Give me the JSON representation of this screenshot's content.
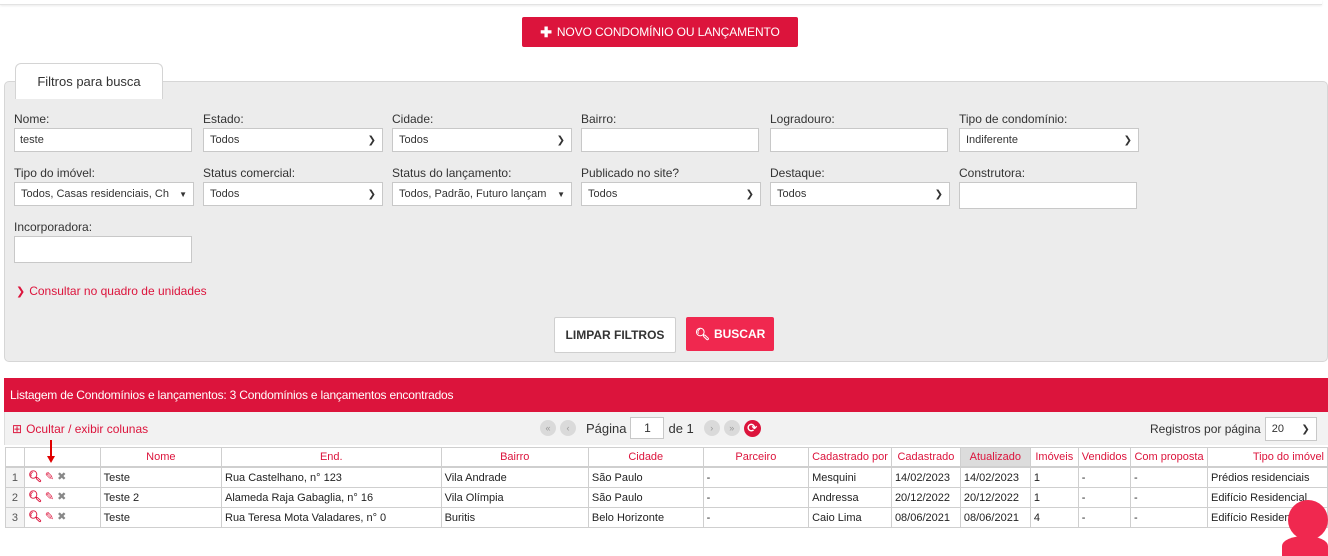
{
  "top_button": {
    "icon": "plus-icon",
    "label": "NOVO CONDOMÍNIO OU LANÇAMENTO"
  },
  "filters": {
    "tab_title": "Filtros para busca",
    "nome": {
      "label": "Nome:",
      "value": "teste"
    },
    "estado": {
      "label": "Estado:",
      "value": "Todos"
    },
    "cidade": {
      "label": "Cidade:",
      "value": "Todos"
    },
    "bairro": {
      "label": "Bairro:",
      "value": ""
    },
    "logradouro": {
      "label": "Logradouro:",
      "value": ""
    },
    "tipo_condominio": {
      "label": "Tipo de condomínio:",
      "value": "Indiferente"
    },
    "tipo_imovel": {
      "label": "Tipo do imóvel:",
      "value": "Todos, Casas residenciais, Ch"
    },
    "status_comercial": {
      "label": "Status comercial:",
      "value": "Todos"
    },
    "status_lancamento": {
      "label": "Status do lançamento:",
      "value": "Todos, Padrão, Futuro lançam"
    },
    "publicado": {
      "label": "Publicado no site?",
      "value": "Todos"
    },
    "destaque": {
      "label": "Destaque:",
      "value": "Todos"
    },
    "construtora": {
      "label": "Construtora:",
      "value": ""
    },
    "incorporadora": {
      "label": "Incorporadora:",
      "value": ""
    },
    "consult_link": "Consultar no quadro de unidades",
    "clear_label": "LIMPAR FILTROS",
    "search_label": "BUSCAR"
  },
  "listing": {
    "title": "Listagem de Condomínios e lançamentos: 3 Condomínios e lançamentos encontrados",
    "toggle_columns": "Ocultar / exibir colunas",
    "page_label": "Página",
    "page_value": "1",
    "page_of": "de 1",
    "per_page_label": "Registros por página",
    "per_page_value": "20",
    "columns": [
      "",
      "",
      "Nome",
      "End.",
      "Bairro",
      "Cidade",
      "Parceiro",
      "Cadastrado por",
      "Cadastrado",
      "Atualizado",
      "Imóveis",
      "Vendidos",
      "Com proposta",
      "Tipo do imóvel"
    ],
    "rows": [
      {
        "n": "1",
        "nome": "Teste",
        "end": "Rua Castelhano, n° 123",
        "bairro": "Vila Andrade",
        "cidade": "São Paulo",
        "parceiro": "-",
        "cad_por": "Mesquini",
        "cadastrado": "14/02/2023",
        "atualizado": "14/02/2023",
        "imoveis": "1",
        "vendidos": "-",
        "proposta": "-",
        "tipo": "Prédios residenciais"
      },
      {
        "n": "2",
        "nome": "Teste 2",
        "end": "Alameda Raja Gabaglia, n° 16",
        "bairro": "Vila Olímpia",
        "cidade": "São Paulo",
        "parceiro": "-",
        "cad_por": "Andressa",
        "cadastrado": "20/12/2022",
        "atualizado": "20/12/2022",
        "imoveis": "1",
        "vendidos": "-",
        "proposta": "-",
        "tipo": "Edifício Residencial"
      },
      {
        "n": "3",
        "nome": "Teste",
        "end": "Rua Teresa Mota Valadares, n° 0",
        "bairro": "Buritis",
        "cidade": "Belo Horizonte",
        "parceiro": "-",
        "cad_por": "Caio Lima",
        "cadastrado": "08/06/2021",
        "atualizado": "08/06/2021",
        "imoveis": "4",
        "vendidos": "-",
        "proposta": "-",
        "tipo": "Edifício Residencial"
      }
    ]
  },
  "colors": {
    "accent": "#dc143c",
    "search_button": "#f0284f",
    "filter_bg": "#ececec"
  }
}
